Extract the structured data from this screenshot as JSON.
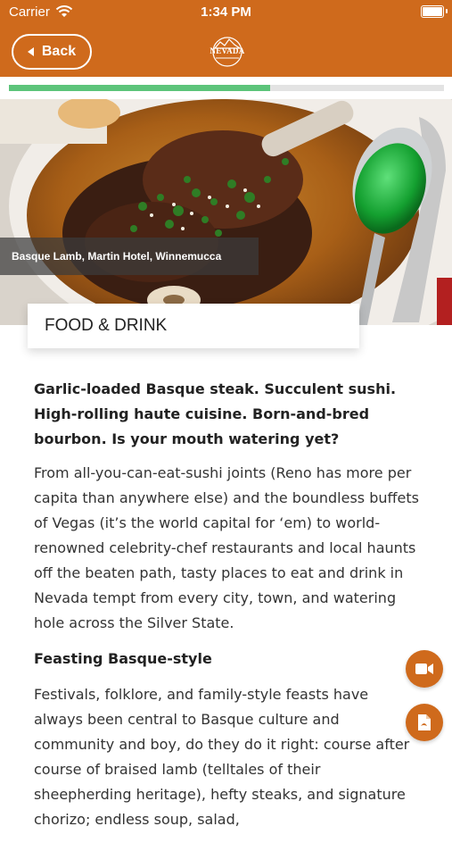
{
  "status_bar": {
    "carrier": "Carrier",
    "time": "1:34 PM"
  },
  "nav": {
    "back_label": "Back",
    "logo_text": "NEVADA"
  },
  "progress": {
    "fraction": 0.6
  },
  "hero": {
    "caption": "Basque Lamb, Martin Hotel, Winnemucca"
  },
  "section": {
    "title": "FOOD & DRINK"
  },
  "article": {
    "lead": "Garlic-loaded Basque steak. Succulent sushi. High-rolling haute cuisine. Born-and-bred bourbon. Is your mouth watering yet?",
    "paragraph1": "From all-you-can-eat-sushi joints (Reno has more per capita than anywhere else) and the boundless buffets of Vegas (it’s the world capital for ‘em) to world-renowned celebrity-chef restaurants and local haunts off the beaten path, tasty places to eat and drink in Nevada tempt from every city, town, and watering hole across the Silver State.",
    "subhead1": "Feasting Basque-style",
    "paragraph2": "Festivals, folklore, and family-style feasts have always been central to Basque culture and community and boy, do they do it right: course after course of braised lamb (telltales of their sheepherding heritage), hefty steaks, and signature chorizo; endless soup, salad,"
  },
  "colors": {
    "brand": "#cf6a1c",
    "progress": "#5cc47a"
  },
  "icons": {
    "video": "video-camera-icon",
    "pdf": "pdf-document-icon"
  }
}
